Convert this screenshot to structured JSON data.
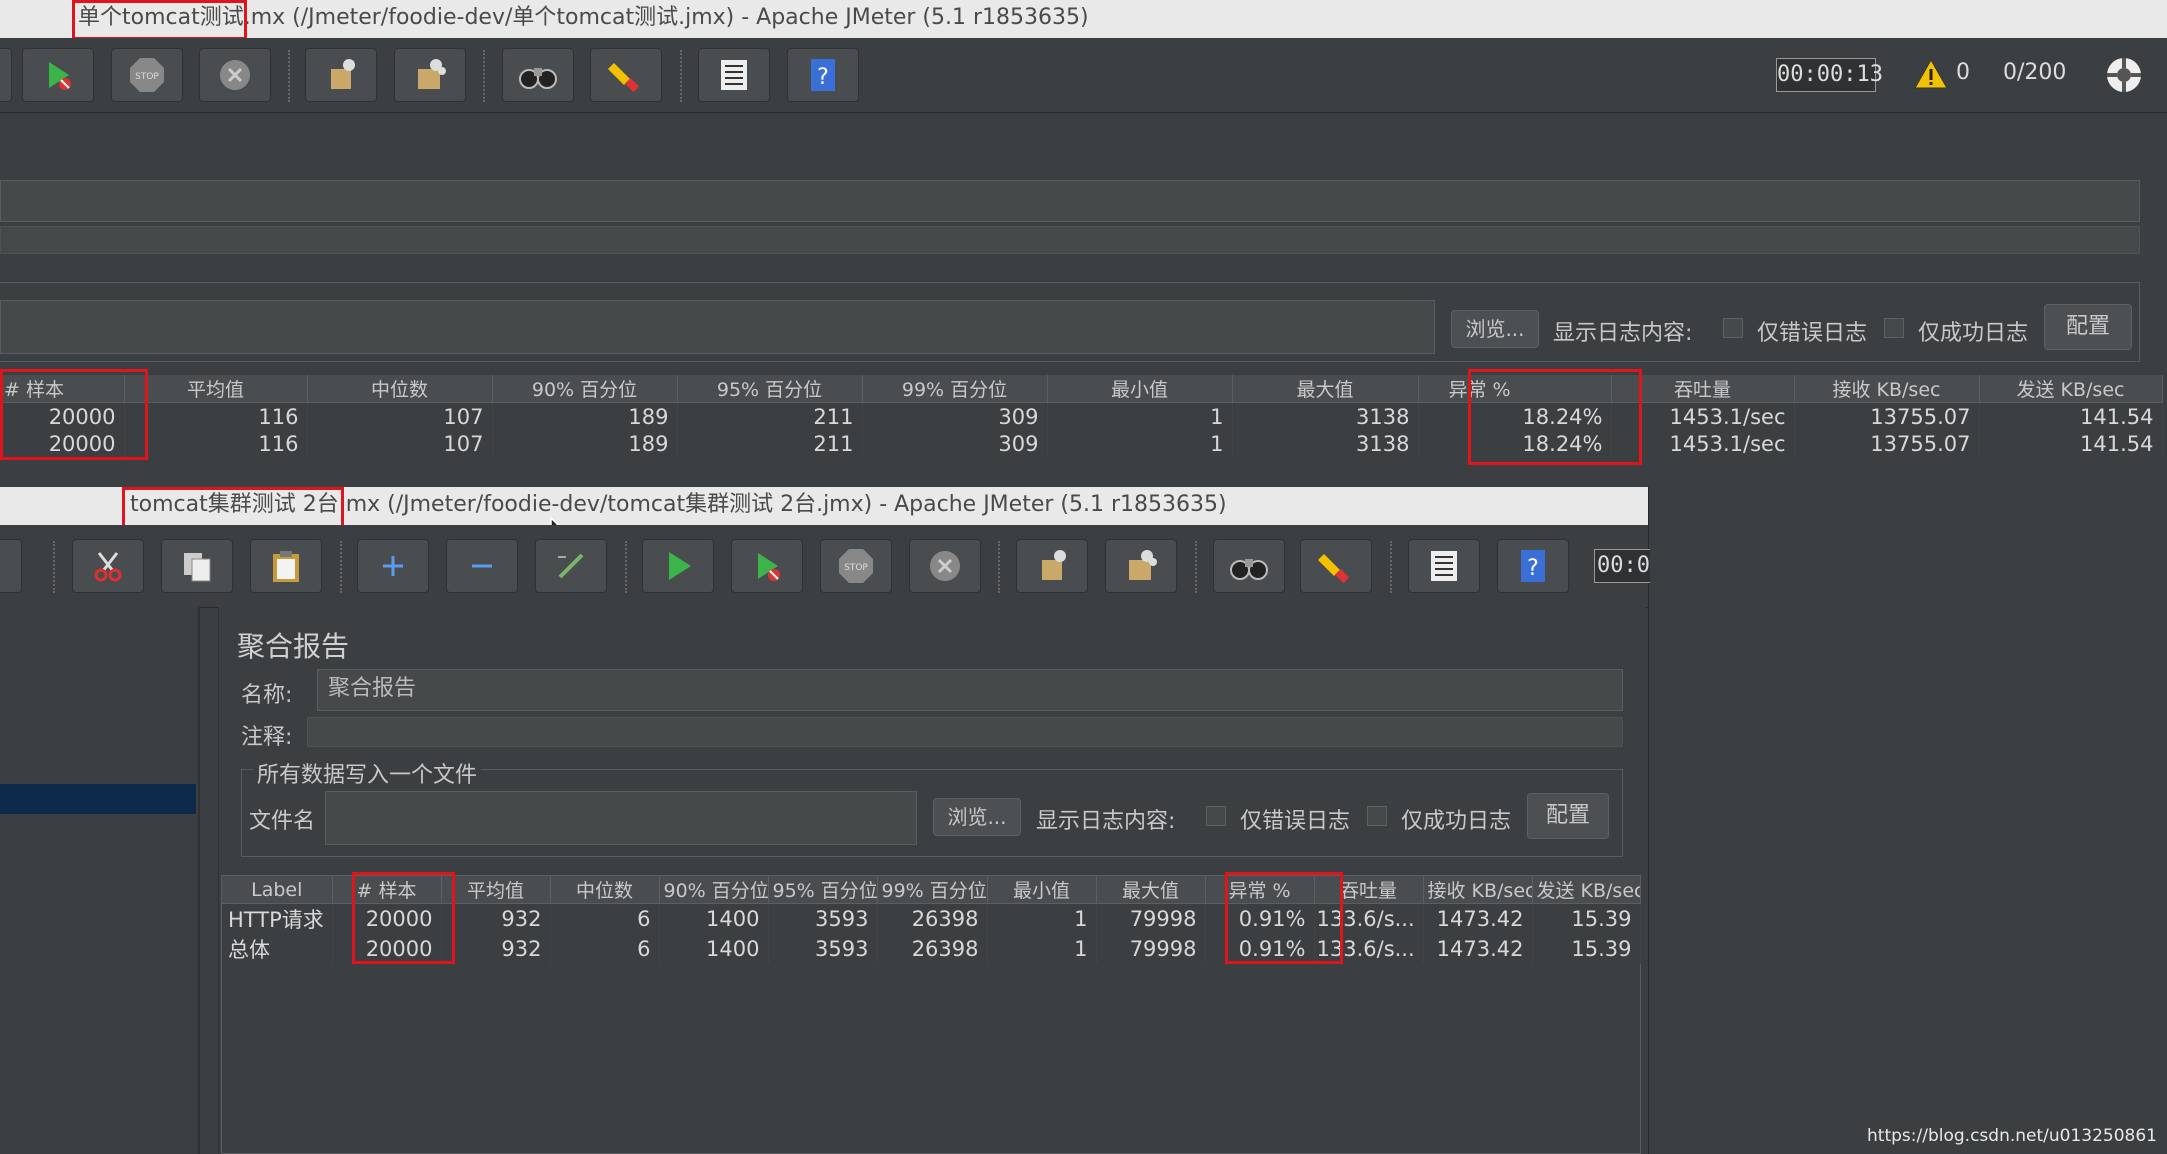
{
  "win1": {
    "title": "单个tomcat测试.mx (/Jmeter/foodie-dev/单个tomcat测试.jmx) - Apache JMeter (5.1 r1853635)",
    "timer": "00:00:13",
    "warnings": "0",
    "threads": "0/200",
    "browse_label": "浏览...",
    "log_label": "显示日志内容:",
    "errors_only": "仅错误日志",
    "success_only": "仅成功日志",
    "config_label": "配置",
    "table": {
      "headers": [
        "# 样本",
        "平均值",
        "中位数",
        "90% 百分位",
        "95% 百分位",
        "99% 百分位",
        "最小值",
        "最大值",
        "异常 %",
        "吞吐量",
        "接收 KB/sec",
        "发送 KB/sec"
      ],
      "rows": [
        [
          "20000",
          "116",
          "107",
          "189",
          "211",
          "309",
          "1",
          "3138",
          "18.24%",
          "1453.1/sec",
          "13755.07",
          "141.54"
        ],
        [
          "20000",
          "116",
          "107",
          "189",
          "211",
          "309",
          "1",
          "3138",
          "18.24%",
          "1453.1/sec",
          "13755.07",
          "141.54"
        ]
      ]
    }
  },
  "win2": {
    "title": "tomcat集群测试 2台.mx (/Jmeter/foodie-dev/tomcat集群测试 2台.jmx) - Apache JMeter (5.1 r1853635)",
    "timer": "00:0",
    "panel_title": "聚合报告",
    "name_label": "名称:",
    "name_value": "聚合报告",
    "comment_label": "注释:",
    "group_label": "所有数据写入一个文件",
    "filename_label": "文件名",
    "browse_label": "浏览...",
    "log_label": "显示日志内容:",
    "errors_only": "仅错误日志",
    "success_only": "仅成功日志",
    "config_label": "配置",
    "table": {
      "headers": [
        "Label",
        "# 样本",
        "平均值",
        "中位数",
        "90% 百分位",
        "95% 百分位",
        "99% 百分位",
        "最小值",
        "最大值",
        "异常 %",
        "吞吐量",
        "接收 KB/sec",
        "发送 KB/sec"
      ],
      "rows": [
        [
          "HTTP请求",
          "20000",
          "932",
          "6",
          "1400",
          "3593",
          "26398",
          "1",
          "79998",
          "0.91%",
          "133.6/s...",
          "1473.42",
          "15.39"
        ],
        [
          "总体",
          "20000",
          "932",
          "6",
          "1400",
          "3593",
          "26398",
          "1",
          "79998",
          "0.91%",
          "133.6/s...",
          "1473.42",
          "15.39"
        ]
      ]
    }
  },
  "watermark": "https://blog.csdn.net/u013250861"
}
